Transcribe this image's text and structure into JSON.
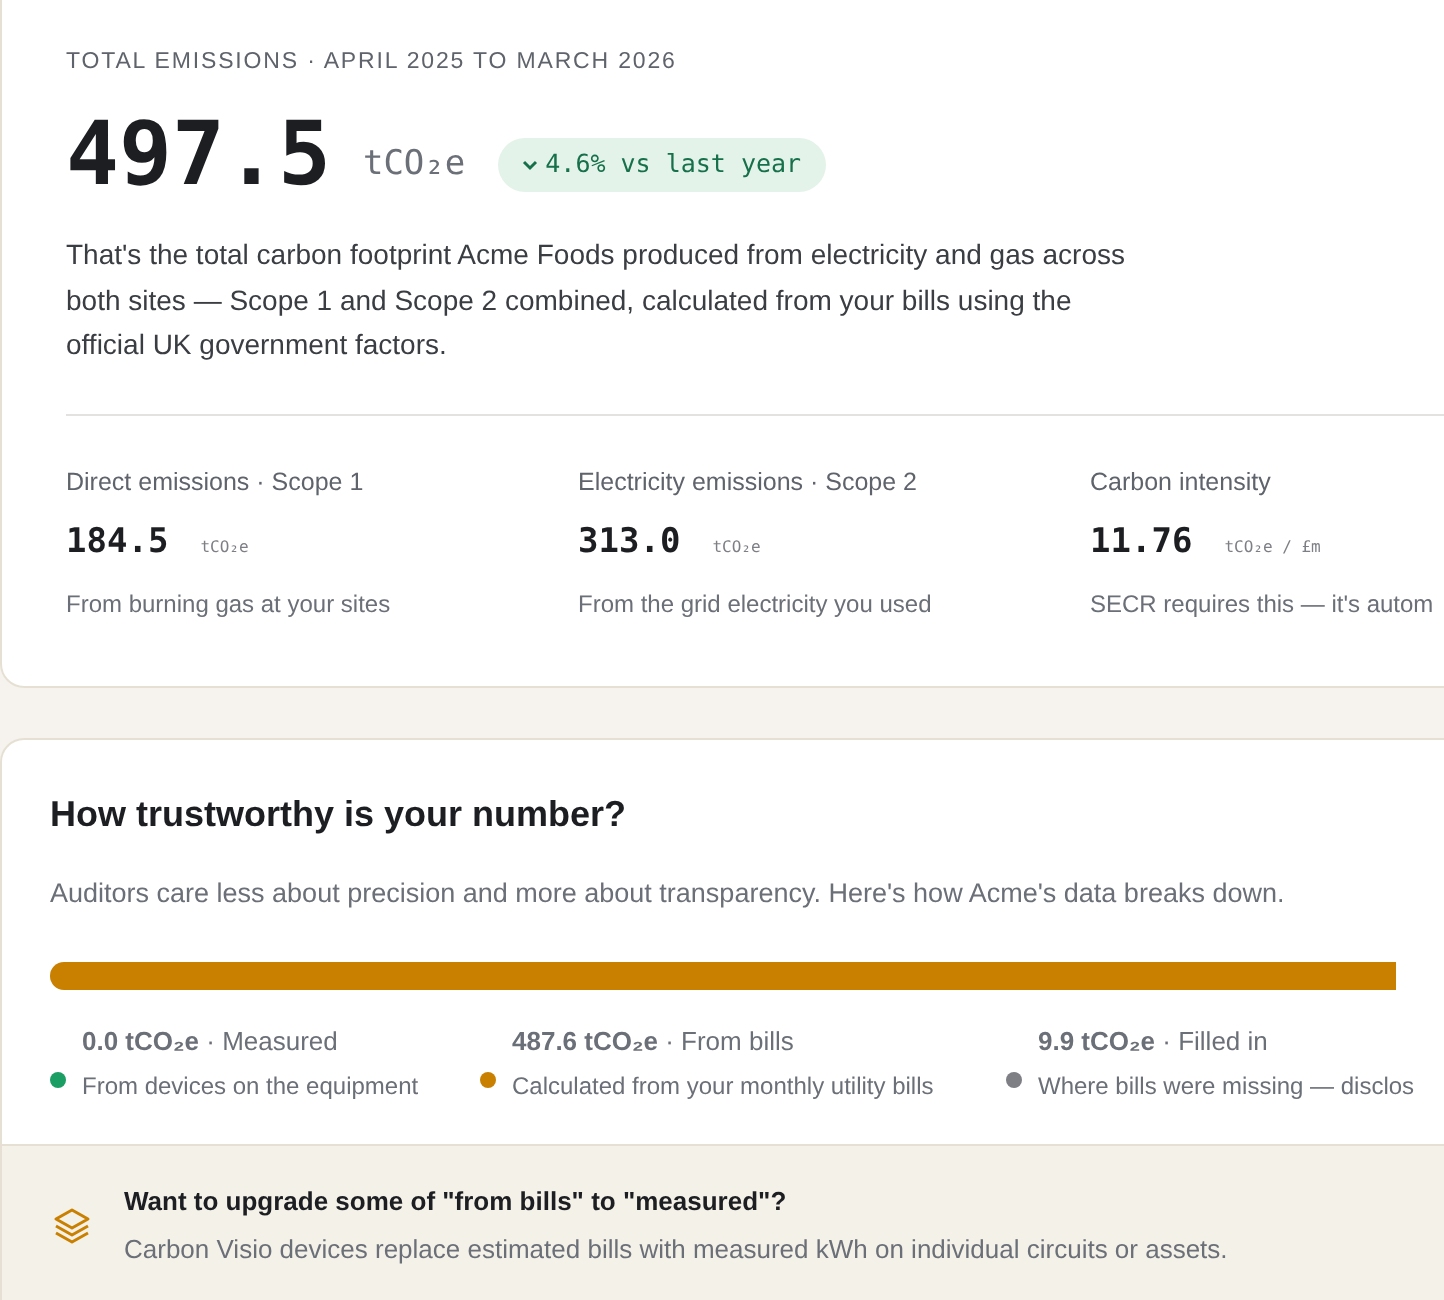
{
  "summary": {
    "eyebrow": "TOTAL EMISSIONS · APRIL 2025 TO MARCH 2026",
    "value": "497.5",
    "unit": "tCO₂e",
    "change": {
      "text": "4.6% vs last year"
    },
    "description": "That's the total carbon footprint Acme Foods produced from electricity and gas across both sites — Scope 1 and Scope 2 combined, calculated from your bills using the official UK government factors.",
    "metrics": [
      {
        "label": "Direct emissions · Scope 1",
        "value": "184.5",
        "unit": "tCO₂e",
        "note": "From burning gas at your sites"
      },
      {
        "label": "Electricity emissions · Scope 2",
        "value": "313.0",
        "unit": "tCO₂e",
        "note": "From the grid electricity you used"
      },
      {
        "label": "Carbon intensity",
        "value": "11.76",
        "unit": "tCO₂e / £m",
        "note": "SECR requires this — it's autom"
      }
    ]
  },
  "trust": {
    "title": "How trustworthy is your number?",
    "subtitle": "Auditors care less about precision and more about transparency. Here's how Acme's data breaks down.",
    "breakdown": [
      {
        "heading": "**0.0 tCO₂e** · Measured",
        "note": "From devices on the equipment",
        "color": "#1a9e63"
      },
      {
        "heading": "**487.6 tCO₂e** · From bills",
        "note": "Calculated from your monthly utility bills",
        "color": "#c98000"
      },
      {
        "heading": "**9.9 tCO₂e** · Filled in",
        "note": "Where bills were missing — disclos",
        "color": "#7d7f85"
      }
    ],
    "upgrade": {
      "title": "Want to upgrade some of \"from bills\" to \"measured\"?",
      "text": "Carbon Visio devices replace estimated bills with measured kWh on individual circuits or assets."
    }
  }
}
